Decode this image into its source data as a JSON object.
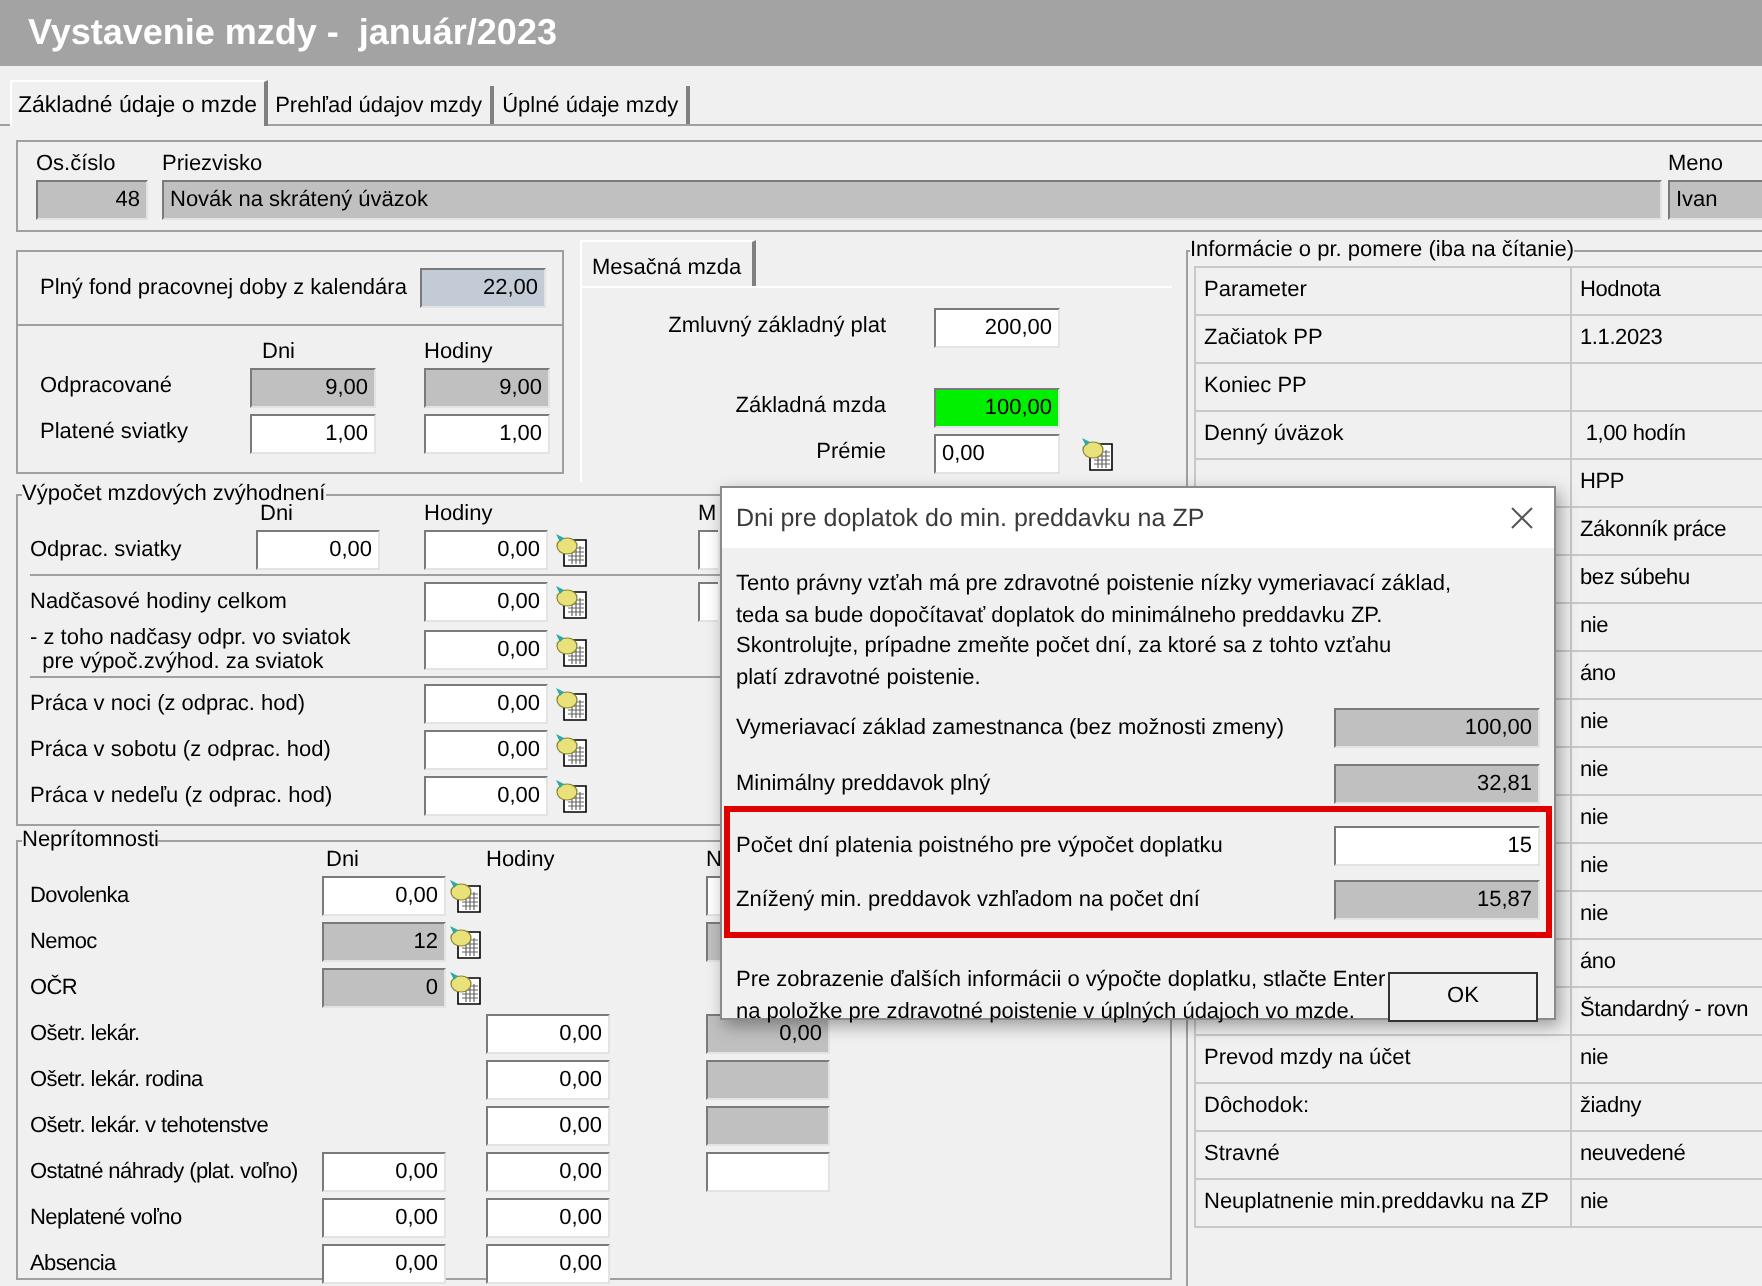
{
  "window": {
    "title": "Vystavenie mzdy -  január/2023"
  },
  "tabs": [
    {
      "label": "Základné údaje o mzde",
      "selected": true
    },
    {
      "label": "Prehľad údajov mzdy",
      "selected": false
    },
    {
      "label": "Úplné údaje mzdy",
      "selected": false
    }
  ],
  "employee": {
    "number_label": "Os.číslo",
    "number": {
      "value": "48",
      "kind": "readonly"
    },
    "surname_label": "Priezvisko",
    "surname": {
      "value": "Novák na skrátený úväzok",
      "kind": "readonly_text"
    },
    "name_label": "Meno",
    "name": {
      "value": "Ivan",
      "kind": "readonly_text"
    }
  },
  "fund": {
    "label": "Plný fond pracovnej doby z kalendára",
    "field": {
      "value": "22,00",
      "kind": "computed"
    }
  },
  "worked": {
    "columns": [
      "Dni",
      "Hodiny"
    ],
    "rows": [
      {
        "label": "Odpracované",
        "days": {
          "value": "9,00",
          "kind": "readonly"
        },
        "hours": {
          "value": "9,00",
          "kind": "readonly"
        }
      },
      {
        "label": "Platené sviatky",
        "days": {
          "value": "1,00",
          "kind": "input"
        },
        "hours": {
          "value": "1,00",
          "kind": "input"
        }
      }
    ]
  },
  "monthly": {
    "tab": "Mesačná mzda",
    "rows": [
      {
        "label": "Zmluvný základný plat",
        "field": {
          "value": "200,00",
          "kind": "input"
        },
        "has_icon": false
      },
      {
        "label": "Základná mzda",
        "field": {
          "value": "100,00",
          "kind": "highlight"
        },
        "has_icon": false
      },
      {
        "label": "Prémie",
        "field": {
          "value": "0,00",
          "kind": "input_text"
        },
        "has_icon": true
      }
    ]
  },
  "bonuses": {
    "title": "Výpočet mzdových zvýhodnení",
    "columns": [
      "Dni",
      "Hodiny",
      "M"
    ],
    "groups": [
      [
        {
          "label": "Odprac. sviatky",
          "days": {
            "value": "0,00",
            "kind": "input"
          },
          "hours": {
            "value": "0,00",
            "kind": "input"
          },
          "has_icon": true,
          "extra": {
            "kind": "input_edge"
          }
        }
      ],
      [
        {
          "label": "Nadčasové hodiny celkom",
          "hours": {
            "value": "0,00",
            "kind": "input"
          },
          "has_icon": true,
          "extra": {
            "kind": "input_edge"
          }
        },
        {
          "label": "- z toho nadčasy odpr. vo sviatok\n  pre výpoč.zvýhod. za sviatok",
          "hours": {
            "value": "0,00",
            "kind": "input"
          },
          "has_icon": true
        }
      ],
      [
        {
          "label": "Práca v noci (z odprac. hod)",
          "hours": {
            "value": "0,00",
            "kind": "input"
          },
          "has_icon": true
        },
        {
          "label": "Práca v sobotu (z odprac. hod)",
          "hours": {
            "value": "0,00",
            "kind": "input"
          },
          "has_icon": true
        },
        {
          "label": "Práca v nedeľu (z odprac. hod)",
          "hours": {
            "value": "0,00",
            "kind": "input"
          },
          "has_icon": true
        }
      ]
    ]
  },
  "absences": {
    "title": "Neprítomnosti",
    "columns": [
      "Dni",
      "Hodiny",
      "N"
    ],
    "rows": [
      {
        "label": "Dovolenka",
        "days": {
          "value": "0,00",
          "kind": "input"
        },
        "has_icon": true,
        "extra": {
          "kind": "input_edge"
        }
      },
      {
        "label": "Nemoc",
        "days": {
          "value": "12",
          "kind": "readonly"
        },
        "has_icon": true,
        "extra": {
          "kind": "readonly_edge"
        }
      },
      {
        "label": "OČR",
        "days": {
          "value": "0",
          "kind": "readonly"
        },
        "has_icon": true
      },
      {
        "label": "Ošetr. lekár.",
        "hours": {
          "value": "0,00",
          "kind": "input"
        },
        "has_icon": false,
        "extra": {
          "value": "0,00",
          "kind": "readonly"
        }
      },
      {
        "label": "Ošetr. lekár. rodina",
        "hours": {
          "value": "0,00",
          "kind": "input"
        },
        "has_icon": false,
        "extra": {
          "kind": "readonly"
        }
      },
      {
        "label": "Ošetr. lekár. v tehotenstve",
        "hours": {
          "value": "0,00",
          "kind": "input"
        },
        "has_icon": false,
        "extra": {
          "kind": "readonly"
        }
      },
      {
        "label": "Ostatné náhrady (plat. voľno)",
        "days": {
          "value": "0,00",
          "kind": "input"
        },
        "hours": {
          "value": "0,00",
          "kind": "input"
        },
        "has_icon": false,
        "extra": {
          "kind": "input"
        }
      },
      {
        "label": "Neplatené voľno",
        "days": {
          "value": "0,00",
          "kind": "input"
        },
        "hours": {
          "value": "0,00",
          "kind": "input"
        },
        "has_icon": false
      },
      {
        "label": "Absencia",
        "days": {
          "value": "0,00",
          "kind": "input"
        },
        "hours": {
          "value": "0,00",
          "kind": "input"
        },
        "has_icon": false
      }
    ]
  },
  "info": {
    "title": "Informácie o pr. pomere (iba na čítanie)",
    "columns": [
      "Parameter",
      "Hodnota"
    ],
    "rows": [
      {
        "parameter": "Začiatok PP",
        "value": "1.1.2023"
      },
      {
        "parameter": "Koniec PP"
      },
      {
        "parameter": "Denný úväzok",
        "value": " 1,00 hodín"
      },
      {
        "value": "HPP"
      },
      {
        "value": "Zákonník práce"
      },
      {
        "value": "bez súbehu"
      },
      {
        "value": "nie"
      },
      {
        "value": "áno"
      },
      {
        "value": "nie"
      },
      {
        "value": "nie"
      },
      {
        "value": "nie"
      },
      {
        "value": "nie"
      },
      {
        "value": "nie"
      },
      {
        "value": "áno"
      },
      {
        "value": "Štandardný - rovn"
      },
      {
        "parameter": "Prevod mzdy na účet",
        "value": "nie"
      },
      {
        "parameter": "Dôchodok:",
        "value": "žiadny"
      },
      {
        "parameter": "Stravné",
        "value": "neuvedené"
      },
      {
        "parameter": "Neuplatnenie min.preddavku na ZP",
        "value": "nie"
      }
    ]
  },
  "dialog": {
    "title": "Dni pre doplatok do min. preddavku na ZP",
    "message": "Tento právny vzťah má pre zdravotné poistenie nízky vymeriavací základ,\nteda sa bude dopočítavať doplatok do minimálneho preddavku ZP.\nSkontrolujte, prípadne zmeňte počet dní, za ktoré sa z tohto vzťahu\nplatí zdravotné poistenie.",
    "rows": [
      {
        "label": "Vymeriavací základ zamestnanca (bez možnosti zmeny)",
        "field": {
          "value": "100,00",
          "kind": "readonly"
        }
      },
      {
        "label": "Minimálny preddavok plný",
        "field": {
          "value": "32,81",
          "kind": "readonly"
        }
      }
    ],
    "highlighted_rows": [
      {
        "label": "Počet dní platenia poistného pre výpočet doplatku",
        "field": {
          "value": "15",
          "kind": "input"
        }
      },
      {
        "label": "Znížený min. preddavok vzhľadom na počet dní",
        "field": {
          "value": "15,87",
          "kind": "readonly"
        }
      }
    ],
    "footer": "Pre zobrazenie ďalších informácii o výpočte doplatku, stlačte Enter\nna položke pre zdravotné poistenie v úplných údajoch vo mzde.",
    "ok_button": "OK"
  }
}
